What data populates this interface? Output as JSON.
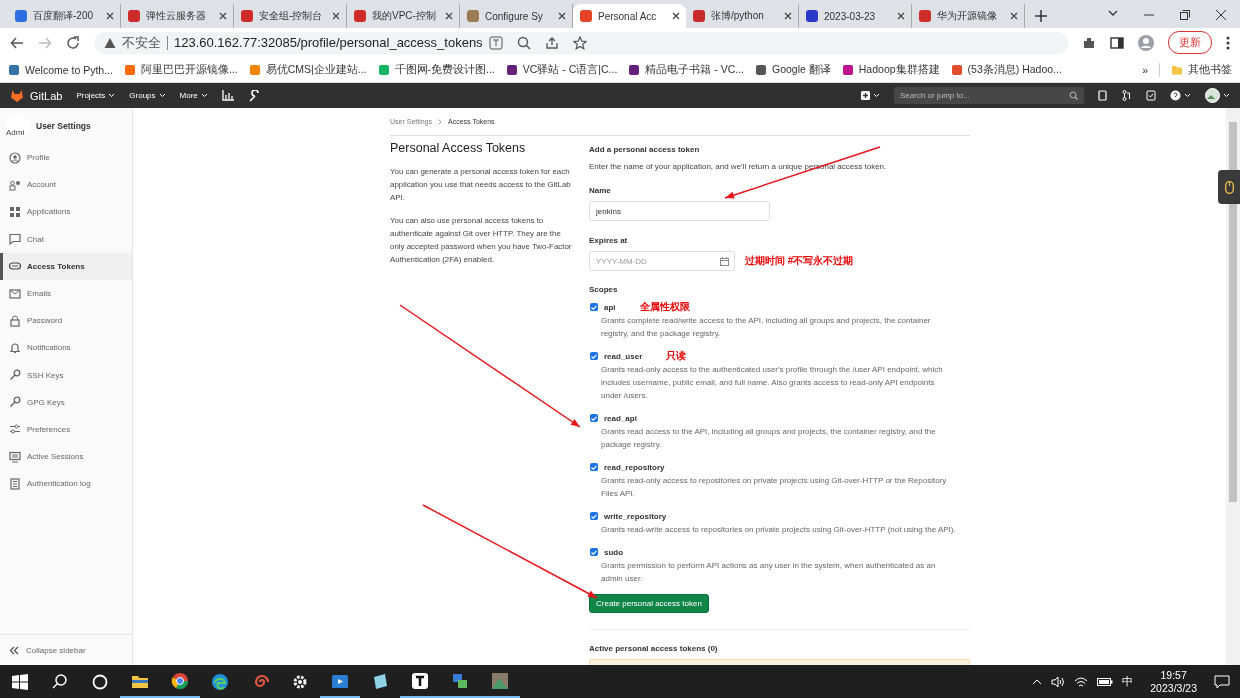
{
  "browser": {
    "tabs": [
      {
        "title": "百度翻译-200",
        "selected": false
      },
      {
        "title": "弹性云服务器",
        "selected": false
      },
      {
        "title": "安全组-控制台",
        "selected": false
      },
      {
        "title": "我的VPC-控制",
        "selected": false
      },
      {
        "title": "Configure Sy",
        "selected": false
      },
      {
        "title": "Personal Acc",
        "selected": true
      },
      {
        "title": "张博/python",
        "selected": false
      },
      {
        "title": "2023-03-23",
        "selected": false
      },
      {
        "title": "华为开源镜像",
        "selected": false
      }
    ],
    "security": "不安全",
    "url": "123.60.162.77:32085/profile/personal_access_tokens",
    "update_button": "更新",
    "bookmarks": [
      "Welcome to Pyth...",
      "阿里巴巴开源镜像...",
      "易优CMS|企业建站...",
      "千图网-免费设计图...",
      "VC驿站 - C语言|C...",
      "精品电子书籍 - VC...",
      "Google 翻译",
      "Hadoop集群搭建",
      "(53条消息) Hadoo..."
    ],
    "bookmarks_overflow": "»",
    "other_bookmarks": "其他书签"
  },
  "gitlab": {
    "logo": "GitLab",
    "nav": [
      "Projects",
      "Groups",
      "More"
    ],
    "search": {
      "placeholder": "Search or jump to..."
    }
  },
  "sidebar": {
    "avatar_alt": "Admi",
    "title": "User Settings",
    "items": [
      {
        "label": "Profile",
        "selected": false
      },
      {
        "label": "Account",
        "selected": false
      },
      {
        "label": "Applications",
        "selected": false
      },
      {
        "label": "Chat",
        "selected": false
      },
      {
        "label": "Access Tokens",
        "selected": true
      },
      {
        "label": "Emails",
        "selected": false
      },
      {
        "label": "Password",
        "selected": false
      },
      {
        "label": "Notifications",
        "selected": false
      },
      {
        "label": "SSH Keys",
        "selected": false
      },
      {
        "label": "GPG Keys",
        "selected": false
      },
      {
        "label": "Preferences",
        "selected": false
      },
      {
        "label": "Active Sessions",
        "selected": false
      },
      {
        "label": "Authentication log",
        "selected": false
      }
    ],
    "collapse": "Collapse sidebar"
  },
  "breadcrumb": [
    "User Settings",
    "Access Tokens"
  ],
  "intro": {
    "title": "Personal Access Tokens",
    "paragraphs": [
      "You can generate a personal access token for each application you use that needs access to the GitLab API.",
      "You can also use personal access tokens to authenticate against Git over HTTP. They are the only accepted password when you have Two-Factor Authentication (2FA) enabled."
    ]
  },
  "form": {
    "heading": "Add a personal access token",
    "description": "Enter the name of your application, and we'll return a unique personal access token.",
    "name": {
      "label": "Name",
      "value": "jenkins"
    },
    "expires": {
      "label": "Expires at",
      "placeholder": "YYYY-MM-DD",
      "note": "过期时间 #不写永不过期"
    },
    "scopes_label": "Scopes",
    "scopes": [
      {
        "name": "api",
        "checked": true,
        "note": "全属性权限",
        "description": "Grants complete read/write access to the API, including all groups and projects, the container registry, and the package registry."
      },
      {
        "name": "read_user",
        "checked": true,
        "note": "只读",
        "description": "Grants read-only access to the authenticated user's profile through the /user API endpoint, which includes username, public email, and full name. Also grants access to read-only API endpoints under /users."
      },
      {
        "name": "read_api",
        "checked": true,
        "description": "Grants read access to the API, including all groups and projects, the container registry, and the package registry."
      },
      {
        "name": "read_repository",
        "checked": true,
        "description": "Grants read-only access to repositories on private projects using Git-over-HTTP or the Repository Files API."
      },
      {
        "name": "write_repository",
        "checked": true,
        "description": "Grants read-write access to repositories on private projects using Git-over-HTTP (not using the API)."
      },
      {
        "name": "sudo",
        "checked": true,
        "description": "Grants permission to perform API actions as any user in the system, when authenticated as an admin user."
      }
    ],
    "submit": "Create personal access token"
  },
  "active_tokens": {
    "heading": "Active personal access tokens (0)"
  },
  "taskbar": {
    "ime": "中",
    "time": "19:57",
    "date": "2023/3/23"
  }
}
